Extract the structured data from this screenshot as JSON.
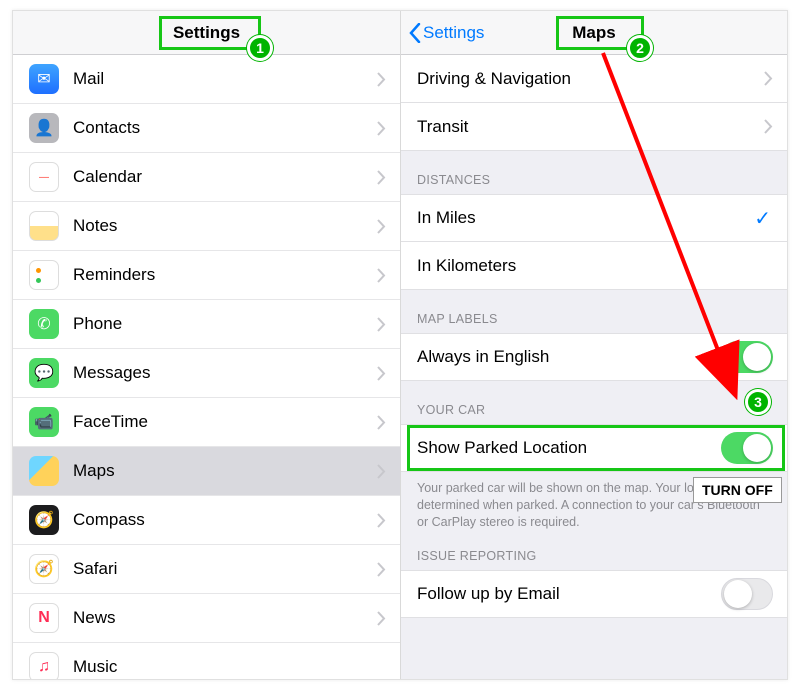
{
  "left": {
    "title": "Settings",
    "items": [
      {
        "label": "Mail",
        "icon": "mail"
      },
      {
        "label": "Contacts",
        "icon": "contacts"
      },
      {
        "label": "Calendar",
        "icon": "calendar"
      },
      {
        "label": "Notes",
        "icon": "notes"
      },
      {
        "label": "Reminders",
        "icon": "reminders"
      },
      {
        "label": "Phone",
        "icon": "phone"
      },
      {
        "label": "Messages",
        "icon": "messages"
      },
      {
        "label": "FaceTime",
        "icon": "facetime"
      },
      {
        "label": "Maps",
        "icon": "maps"
      },
      {
        "label": "Compass",
        "icon": "compass"
      },
      {
        "label": "Safari",
        "icon": "safari"
      },
      {
        "label": "News",
        "icon": "news"
      },
      {
        "label": "Music",
        "icon": "music"
      }
    ]
  },
  "right": {
    "back_label": "Settings",
    "title": "Maps",
    "rows": {
      "driving": "Driving & Navigation",
      "transit": "Transit"
    },
    "distances": {
      "header": "DISTANCES",
      "miles": "In Miles",
      "km": "In Kilometers"
    },
    "map_labels": {
      "header": "MAP LABELS",
      "english": "Always in English"
    },
    "your_car": {
      "header": "YOUR CAR",
      "show_parked": "Show Parked Location",
      "footer": "Your parked car will be shown on the map. Your location can be determined when parked. A connection to your car's Bluetooth or CarPlay stereo is required."
    },
    "issue": {
      "header": "ISSUE REPORTING",
      "follow": "Follow up by Email"
    }
  },
  "annotations": {
    "step1": "1",
    "step2": "2",
    "step3": "3",
    "turn_off": "TURN OFF"
  }
}
